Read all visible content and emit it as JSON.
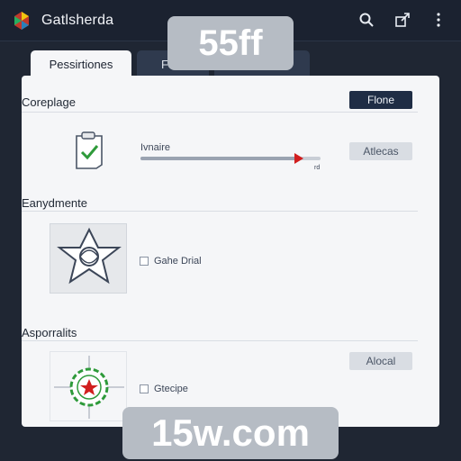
{
  "app": {
    "title": "Gatlsherda",
    "logo_icon": "app-logo-icon"
  },
  "topbar_icons": [
    "search-icon",
    "share-icon",
    "more-vert-icon"
  ],
  "tabs": [
    {
      "label": "Pessirtiones",
      "active": true
    },
    {
      "label": "Fo...",
      "active": false
    },
    {
      "label": "",
      "active": false
    }
  ],
  "sections": [
    {
      "title": "Coreplage",
      "action_label": "Flone",
      "icon": "clipboard-check-icon",
      "slider": {
        "label": "Ivnaire",
        "value_label": "rd",
        "value_fraction": 0.88
      },
      "secondary_label": "Atlecas"
    },
    {
      "title": "Eanydmente",
      "icon": "star-emblem-icon",
      "checkbox_label": "Gahe Drial"
    },
    {
      "title": "Asporralits",
      "icon": "target-star-icon",
      "checkbox_label": "Gtecipe",
      "secondary_label": "Alocal"
    }
  ],
  "overlays": {
    "top": "55ff",
    "bottom": "15w.com"
  },
  "colors": {
    "bg": "#1f2633",
    "panel": "#f5f6f8",
    "primary": "#1f2d45",
    "accent_red": "#d11e1e",
    "green": "#2e9a3a"
  }
}
